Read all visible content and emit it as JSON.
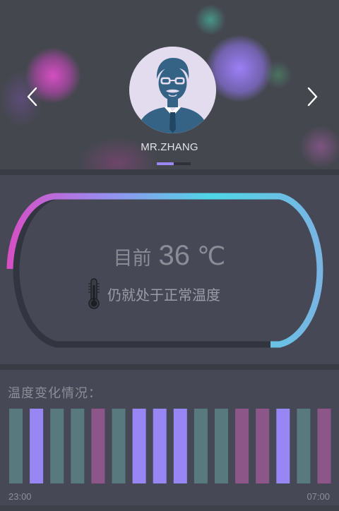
{
  "header": {
    "user_name": "MR.ZHANG",
    "avatar_icon": "businessman-avatar-icon",
    "prev_icon": "chevron-left-icon",
    "next_icon": "chevron-right-icon",
    "pager": {
      "active_index": 0,
      "count": 2
    }
  },
  "temperature": {
    "prefix": "目前",
    "value": "36",
    "unit": "℃",
    "status": "仍就处于正常温度",
    "status_icon": "thermometer-icon",
    "progress": 0.6,
    "gradient_colors": [
      "#d64fc5",
      "#9a8cef",
      "#4fd6e6",
      "#79b4e3"
    ],
    "track_color": "#323540"
  },
  "history": {
    "title": "温度变化情况：",
    "start_time": "23:00",
    "end_time": "07:00",
    "bars": [
      {
        "level": "teal"
      },
      {
        "level": "violet"
      },
      {
        "level": "teal"
      },
      {
        "level": "teal"
      },
      {
        "level": "plum"
      },
      {
        "level": "teal"
      },
      {
        "level": "violet"
      },
      {
        "level": "violet"
      },
      {
        "level": "violet"
      },
      {
        "level": "teal"
      },
      {
        "level": "teal"
      },
      {
        "level": "plum"
      },
      {
        "level": "plum"
      },
      {
        "level": "violet"
      },
      {
        "level": "teal"
      },
      {
        "level": "plum"
      }
    ],
    "colors": {
      "teal": "#58797e",
      "violet": "#9886f5",
      "plum": "#8c5788"
    }
  }
}
